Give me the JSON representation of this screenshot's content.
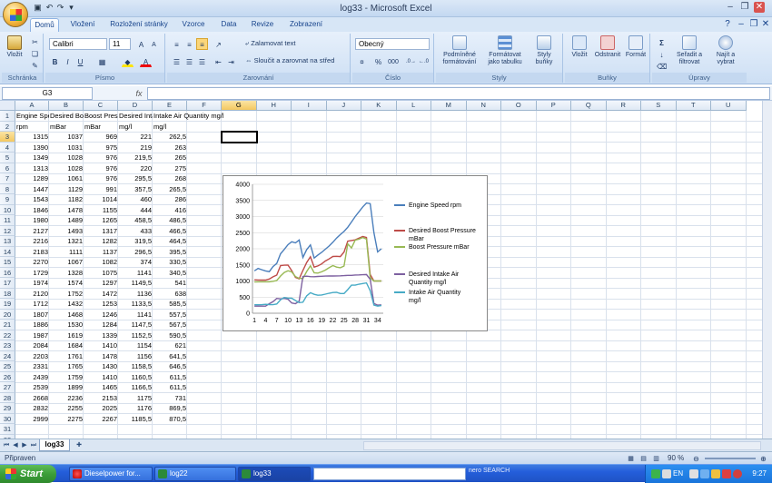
{
  "window": {
    "title": "log33 - Microsoft Excel"
  },
  "tabs": [
    "Domů",
    "Vložení",
    "Rozložení stránky",
    "Vzorce",
    "Data",
    "Revize",
    "Zobrazení"
  ],
  "ribbon": {
    "paste_label": "Vložit",
    "clipboard_label": "Schránka",
    "font_name": "Calibri",
    "font_size": "11",
    "bold": "B",
    "italic": "I",
    "underline": "U",
    "font_label": "Písmo",
    "wrap_text": "Zalamovat text",
    "merge_center": "Sloučit a zarovnat na střed",
    "alignment_label": "Zarovnání",
    "number_format": "Obecný",
    "percent": "%",
    "thousands": "000",
    "number_label": "Číslo",
    "conditional_formatting": "Podmíněné formátování",
    "format_as_table": "Formátovat jako tabulku",
    "cell_styles": "Styly buňky",
    "styles_label": "Styly",
    "insert": "Vložit",
    "delete": "Odstranit",
    "format": "Formát",
    "cells_label": "Buňky",
    "sort_filter": "Seřadit a filtrovat",
    "find_select": "Najít a vybrat",
    "editing_label": "Úpravy",
    "sigma": "Σ"
  },
  "formula_bar": {
    "name_box": "G3",
    "fx": "fx",
    "formula": ""
  },
  "columns": [
    "A",
    "B",
    "C",
    "D",
    "E",
    "F",
    "G",
    "H",
    "I",
    "J",
    "K",
    "L",
    "M",
    "N",
    "O",
    "P",
    "Q",
    "R",
    "S",
    "T",
    "U"
  ],
  "selected_column": "G",
  "selected_row": 3,
  "header_rows": [
    [
      "Engine Speed rpm",
      "Desired Boost Pressure mBar",
      "Boost Pressure mBar",
      "Desired Intake Air Quantity mg/l",
      "Intake Air Quantity mg/l"
    ],
    [
      "rpm",
      "mBar",
      "mBar",
      "mg/l",
      "mg/l"
    ]
  ],
  "rows": [
    [
      "1315",
      "1037",
      "969",
      "221",
      "262,5"
    ],
    [
      "1390",
      "1031",
      "975",
      "219",
      "263"
    ],
    [
      "1349",
      "1028",
      "976",
      "219,5",
      "265"
    ],
    [
      "1313",
      "1028",
      "976",
      "220",
      "275"
    ],
    [
      "1289",
      "1061",
      "976",
      "295,5",
      "268"
    ],
    [
      "1447",
      "1129",
      "991",
      "357,5",
      "265,5"
    ],
    [
      "1543",
      "1182",
      "1014",
      "460",
      "286"
    ],
    [
      "1846",
      "1478",
      "1155",
      "444",
      "416"
    ],
    [
      "1980",
      "1489",
      "1265",
      "458,5",
      "486,5"
    ],
    [
      "2127",
      "1493",
      "1317",
      "433",
      "466,5"
    ],
    [
      "2216",
      "1321",
      "1282",
      "319,5",
      "464,5"
    ],
    [
      "2183",
      "1111",
      "1137",
      "296,5",
      "395,5"
    ],
    [
      "2270",
      "1067",
      "1082",
      "374",
      "330,5"
    ],
    [
      "1729",
      "1328",
      "1075",
      "1141",
      "340,5"
    ],
    [
      "1974",
      "1574",
      "1297",
      "1149,5",
      "541"
    ],
    [
      "2120",
      "1752",
      "1472",
      "1136",
      "638"
    ],
    [
      "1712",
      "1432",
      "1253",
      "1133,5",
      "585,5"
    ],
    [
      "1807",
      "1468",
      "1246",
      "1141",
      "557,5"
    ],
    [
      "1886",
      "1530",
      "1284",
      "1147,5",
      "567,5"
    ],
    [
      "1987",
      "1619",
      "1339",
      "1152,5",
      "590,5"
    ],
    [
      "2084",
      "1684",
      "1410",
      "1154",
      "621"
    ],
    [
      "2203",
      "1761",
      "1478",
      "1156",
      "641,5"
    ],
    [
      "2331",
      "1765",
      "1430",
      "1158,5",
      "646,5"
    ],
    [
      "2439",
      "1759",
      "1410",
      "1160,5",
      "611,5"
    ],
    [
      "2539",
      "1899",
      "1465",
      "1166,5",
      "611,5"
    ],
    [
      "2668",
      "2236",
      "2153",
      "1175",
      "731"
    ],
    [
      "2832",
      "2255",
      "2025",
      "1176",
      "869,5"
    ],
    [
      "2999",
      "2275",
      "2267",
      "1185,5",
      "870,5"
    ]
  ],
  "sheet": {
    "tab": "log33"
  },
  "status": {
    "ready": "Připraven",
    "zoom": "90 %"
  },
  "taskbar": {
    "start": "Start",
    "tasks": [
      "Dieselpower for...",
      "log22",
      "log33"
    ],
    "nero": "nero SEARCH",
    "lang": "EN",
    "clock": "9:27"
  },
  "chart_data": {
    "type": "line",
    "x": [
      1,
      2,
      3,
      4,
      5,
      6,
      7,
      8,
      9,
      10,
      11,
      12,
      13,
      14,
      15,
      16,
      17,
      18,
      19,
      20,
      21,
      22,
      23,
      24,
      25,
      26,
      27,
      28,
      29,
      30,
      31,
      32,
      33,
      34,
      35
    ],
    "x_ticks": [
      "1",
      "4",
      "7",
      "10",
      "13",
      "16",
      "19",
      "22",
      "25",
      "28",
      "31",
      "34"
    ],
    "y_ticks": [
      "0",
      "500",
      "1000",
      "1500",
      "2000",
      "2500",
      "3000",
      "3500",
      "4000"
    ],
    "ylim": [
      0,
      4000
    ],
    "series": [
      {
        "name": "Engine Speed rpm",
        "color": "#4a7ebb",
        "values": [
          1315,
          1390,
          1349,
          1313,
          1289,
          1447,
          1543,
          1846,
          1980,
          2127,
          2216,
          2183,
          2270,
          1729,
          1974,
          2120,
          1712,
          1807,
          1886,
          1987,
          2084,
          2203,
          2331,
          2439,
          2539,
          2668,
          2832,
          2999,
          3150,
          3300,
          3420,
          3400,
          2500,
          1900,
          2000
        ]
      },
      {
        "name": "Desired Boost Pressure mBar",
        "color": "#be4b48",
        "values": [
          1037,
          1031,
          1028,
          1028,
          1061,
          1129,
          1182,
          1478,
          1489,
          1493,
          1321,
          1111,
          1067,
          1328,
          1574,
          1752,
          1432,
          1468,
          1530,
          1619,
          1684,
          1761,
          1765,
          1759,
          1899,
          2236,
          2255,
          2275,
          2330,
          2380,
          2350,
          1200,
          1000,
          1000,
          1000
        ]
      },
      {
        "name": "Boost Pressure mBar",
        "color": "#98b954",
        "values": [
          969,
          975,
          976,
          976,
          976,
          991,
          1014,
          1155,
          1265,
          1317,
          1282,
          1137,
          1082,
          1075,
          1297,
          1472,
          1253,
          1246,
          1284,
          1339,
          1410,
          1478,
          1430,
          1410,
          1465,
          2153,
          2025,
          2267,
          2300,
          2350,
          2300,
          1100,
          1000,
          1000,
          1000
        ]
      },
      {
        "name": "Desired Intake Air Quantity mg/l",
        "color": "#7d60a0",
        "values": [
          221,
          219,
          219.5,
          220,
          295.5,
          357.5,
          460,
          444,
          458.5,
          433,
          319.5,
          296.5,
          374,
          1141,
          1149.5,
          1136,
          1133.5,
          1141,
          1147.5,
          1152.5,
          1154,
          1156,
          1158.5,
          1160.5,
          1166.5,
          1175,
          1176,
          1185.5,
          1190,
          1195,
          1200,
          1050,
          300,
          250,
          260
        ]
      },
      {
        "name": "Intake Air Quantity mg/l",
        "color": "#46aac5",
        "values": [
          262.5,
          263,
          265,
          275,
          268,
          265.5,
          286,
          416,
          486.5,
          466.5,
          464.5,
          395.5,
          330.5,
          340.5,
          541,
          638,
          585.5,
          557.5,
          567.5,
          590.5,
          621,
          641.5,
          646.5,
          611.5,
          611.5,
          731,
          869.5,
          870.5,
          900,
          920,
          940,
          700,
          250,
          220,
          240
        ]
      }
    ]
  }
}
